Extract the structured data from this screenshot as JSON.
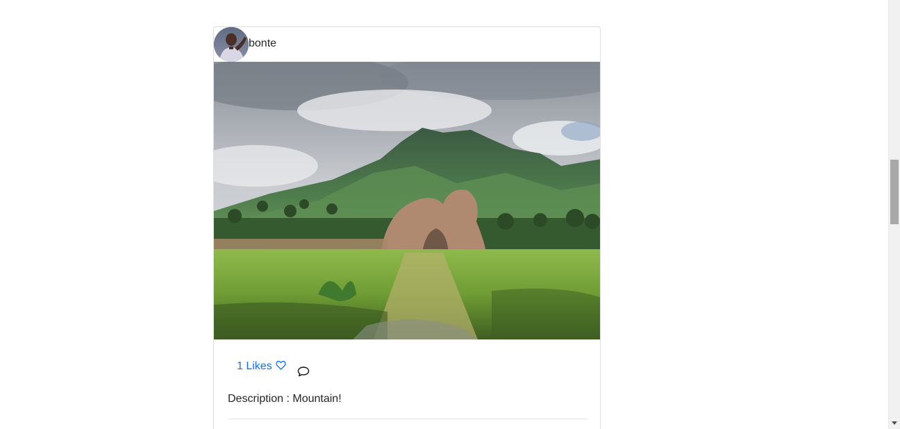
{
  "post": {
    "username": "bonte",
    "likes_label": "1 Likes",
    "description": "Description : Mountain!",
    "icons": {
      "heart": "heart-outline-icon",
      "comment": "chat-bubble-icon"
    },
    "colors": {
      "link": "#0d6efd",
      "text": "#212529",
      "border": "#dcdcdc"
    }
  }
}
